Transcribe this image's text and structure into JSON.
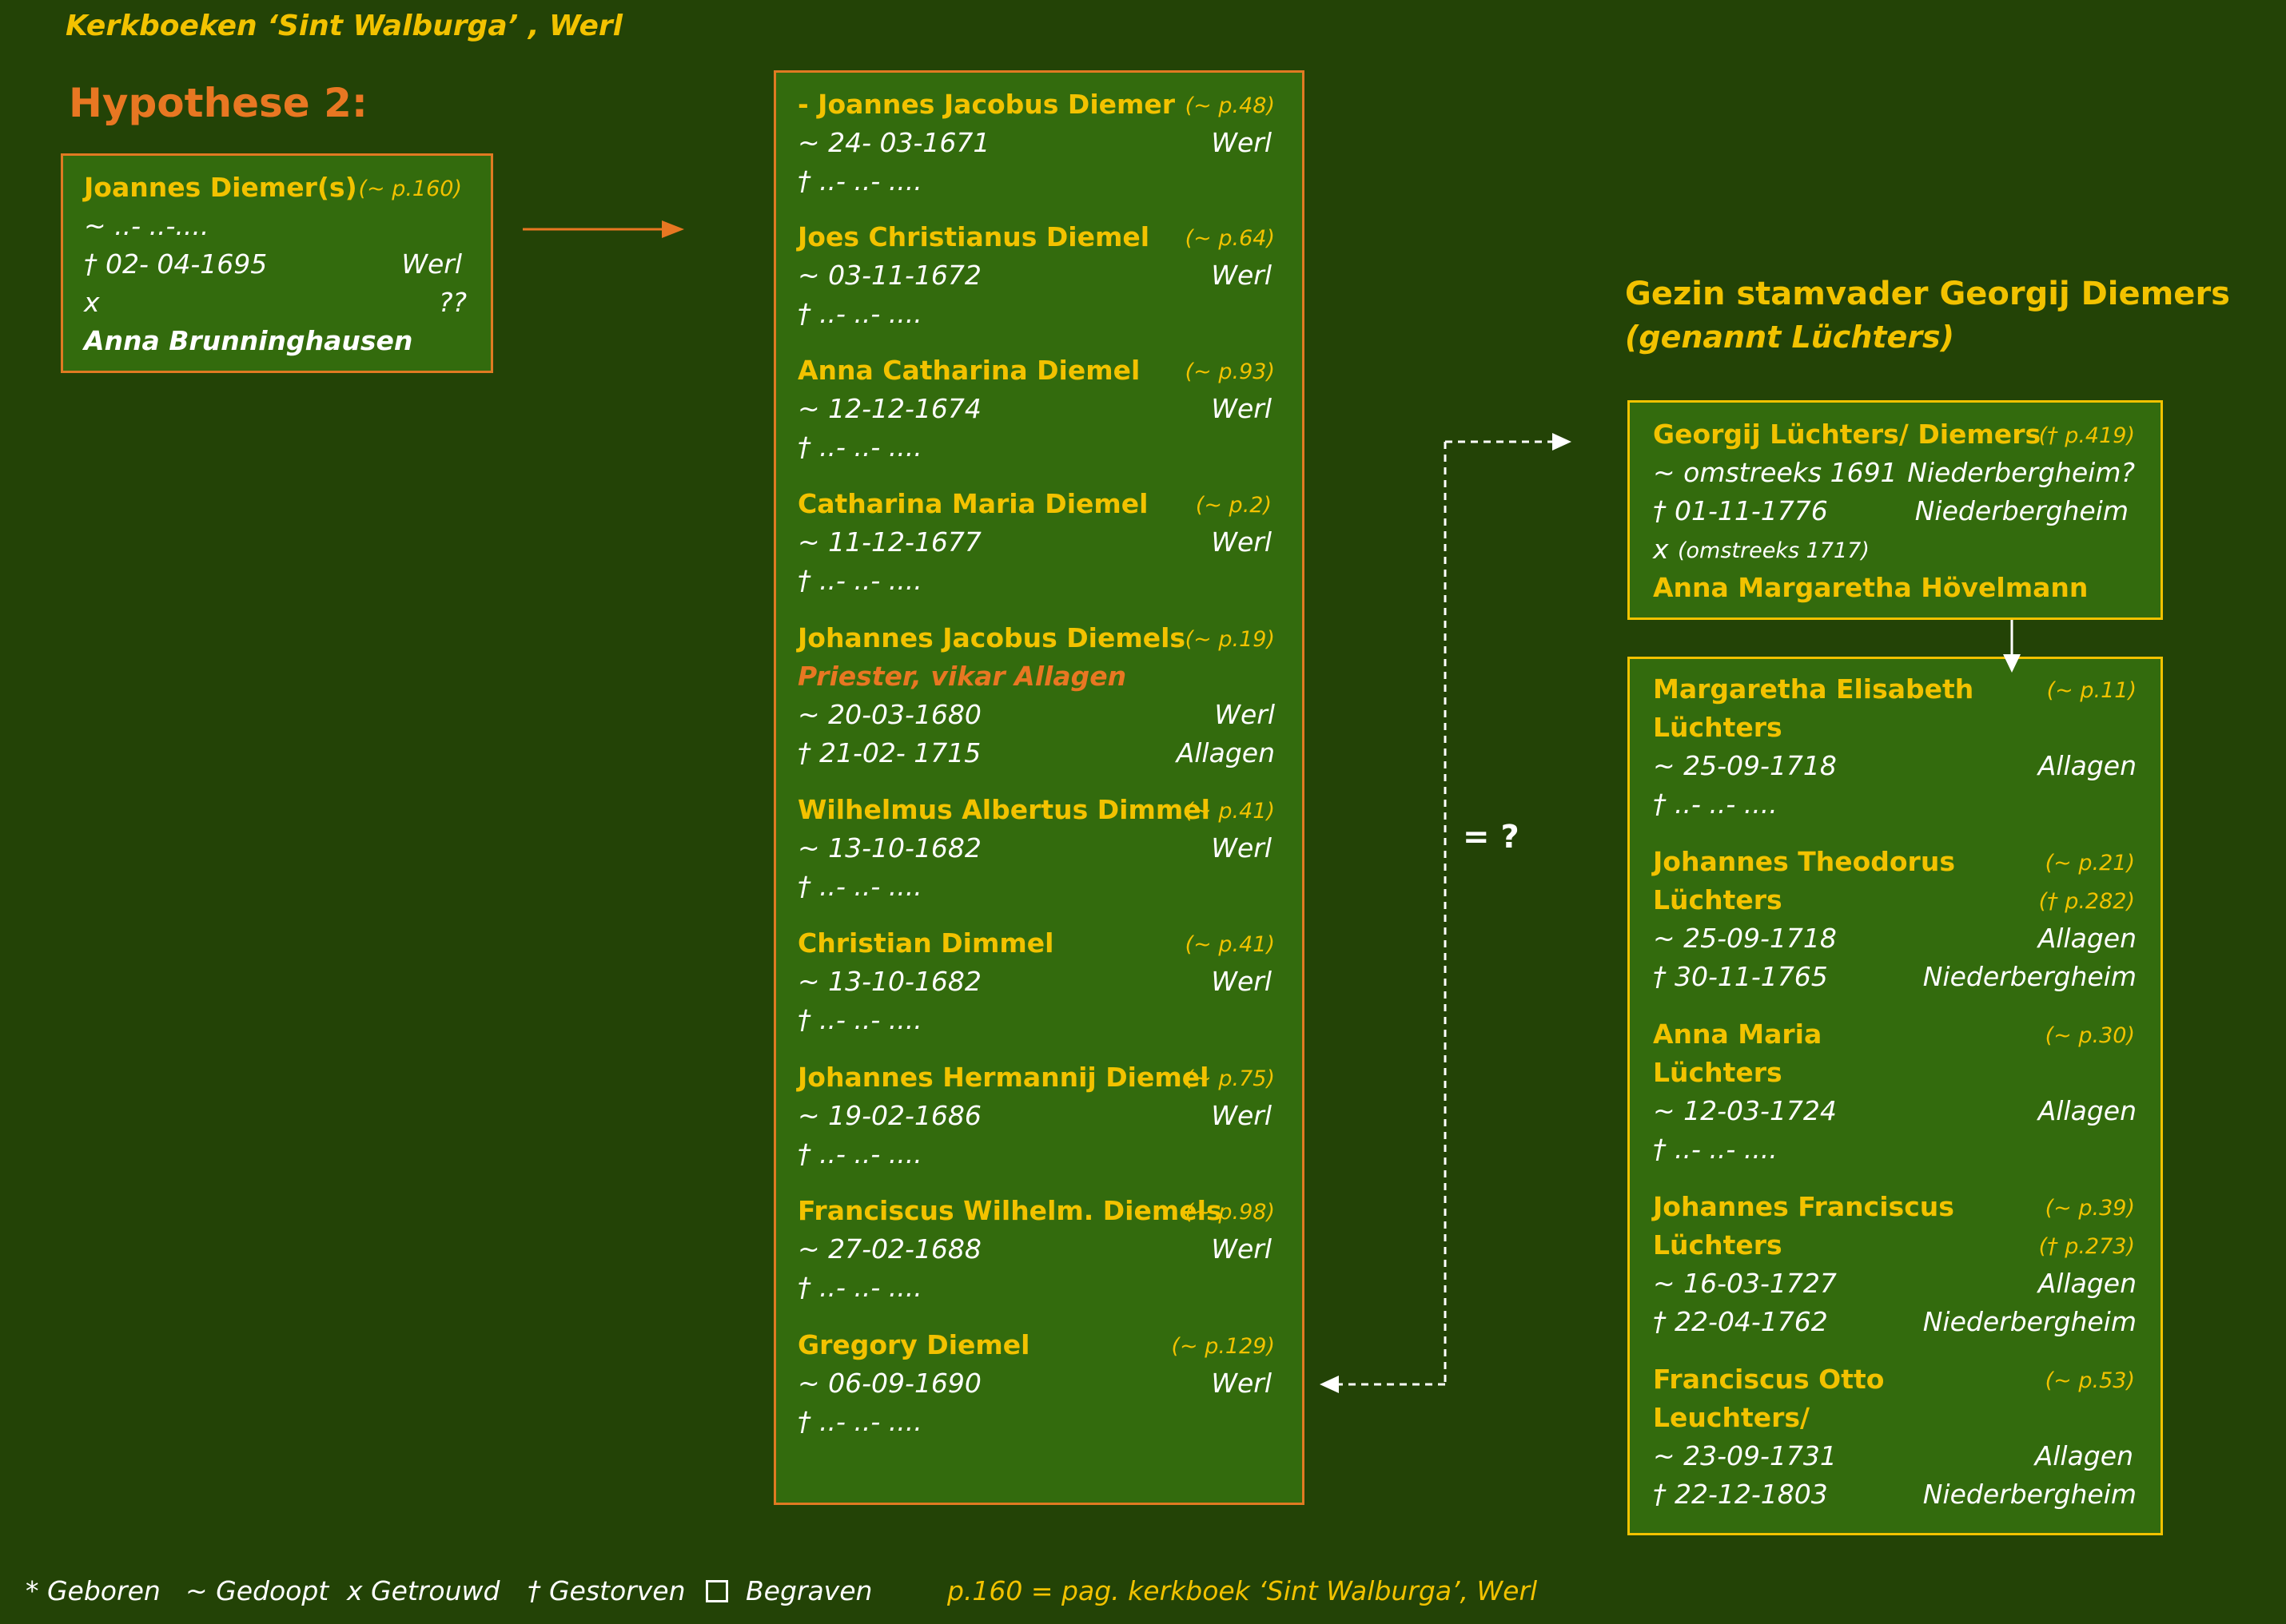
{
  "header": {
    "title": "Kerkboeken ‘Sint Walburga’ , Werl",
    "hypothesis": "Hypothese 2:"
  },
  "father": {
    "name": "Joannes Diemer(s)",
    "ref": "(~ p.160)",
    "baptism": "~ ..- ..-....",
    "death": "† 02- 04-1695",
    "death_place": "Werl",
    "marriage": "x",
    "marriage_note": "??",
    "spouse": "Anna Brunninghausen"
  },
  "children": [
    {
      "name": "- Joannes Jacobus  Diemer",
      "ref": "(~ p.48)",
      "baptism": "~ 24- 03-1671",
      "baptism_place": "Werl",
      "death": "† ..- ..- ...."
    },
    {
      "name": "Joes Christianus Diemel",
      "ref": "(~ p.64)",
      "baptism": "~ 03-11-1672",
      "baptism_place": "Werl",
      "death": "† ..- ..- ...."
    },
    {
      "name": "Anna Catharina Diemel",
      "ref": "(~ p.93)",
      "baptism": "~ 12-12-1674",
      "baptism_place": "Werl",
      "death": "† ..- ..- ...."
    },
    {
      "name": "Catharina Maria Diemel",
      "ref": "(~ p.2)",
      "baptism": "~ 11-12-1677",
      "baptism_place": "Werl",
      "death": "† ..- ..- ...."
    },
    {
      "name": "Johannes Jacobus  Diemels",
      "ref": "(~ p.19)",
      "note": "Priester, vikar Allagen",
      "baptism": "~ 20-03-1680",
      "baptism_place": "Werl",
      "death": "† 21-02- 1715",
      "death_place": "Allagen"
    },
    {
      "name": "Wilhelmus Albertus Dimmel",
      "ref": "(~ p.41)",
      "baptism": "~ 13-10-1682",
      "baptism_place": "Werl",
      "death": "† ..- ..- ...."
    },
    {
      "name": "Christian Dimmel",
      "ref": "(~ p.41)",
      "baptism": "~ 13-10-1682",
      "baptism_place": "Werl",
      "death": "† ..- ..- ...."
    },
    {
      "name": "Johannes Hermannij  Diemel",
      "ref": "(~ p.75)",
      "baptism": "~ 19-02-1686",
      "baptism_place": "Werl",
      "death": "† ..- ..- ...."
    },
    {
      "name": "Franciscus Wilhelm. Diemels",
      "ref": "(~ p.98)",
      "baptism": "~ 27-02-1688",
      "baptism_place": "Werl",
      "death": "† ..- ..- ...."
    },
    {
      "name": "Gregory Diemel",
      "ref": "(~ p.129)",
      "baptism": "~ 06-09-1690",
      "baptism_place": "Werl",
      "death": "† ..- ..- ...."
    }
  ],
  "equals_label": "= ?",
  "family_heading": {
    "line1": "Gezin stamvader  Georgij Diemers",
    "line2": "(genannt Lüchters)"
  },
  "georgij": {
    "name": "Georgij Lüchters/ Diemers",
    "ref": "(† p.419)",
    "baptism": "~ omstreeks 1691",
    "baptism_place": "Niederbergheim?",
    "death": "† 01-11-1776",
    "death_place": "Niederbergheim",
    "marriage": "x",
    "marriage_note": "(omstreeks 1717)",
    "spouse": "Anna Margaretha Hövelmann"
  },
  "georgij_children": [
    {
      "name1": "Margaretha Elisabeth",
      "name2": "Lüchters",
      "ref1": "(~ p.11)",
      "ref2": "",
      "baptism": "~  25-09-1718",
      "baptism_place": "Allagen",
      "death": "†  ..-  ..-   ....",
      "death_place": ""
    },
    {
      "name1": "Johannes Theodorus",
      "name2": "Lüchters",
      "ref1": "(~ p.21)",
      "ref2": "(† p.282)",
      "baptism": "~  25-09-1718",
      "baptism_place": "Allagen",
      "death": "†  30-11-1765",
      "death_place": "Niederbergheim"
    },
    {
      "name1": "Anna Maria",
      "name2": "Lüchters",
      "ref1": "(~ p.30)",
      "ref2": "",
      "baptism": "~ 12-03-1724",
      "baptism_place": "Allagen",
      "death": "†  ..-  ..-   ....",
      "death_place": ""
    },
    {
      "name1": "Johannes Franciscus",
      "name2": "Lüchters",
      "ref1": "(~ p.39)",
      "ref2": "(† p.273)",
      "baptism": "~  16-03-1727",
      "baptism_place": "Allagen",
      "death": "†  22-04-1762",
      "death_place": "Niederbergheim"
    },
    {
      "name1": "Franciscus Otto",
      "name2": "Leuchters/",
      "ref1": "(~ p.53)",
      "ref2": "",
      "baptism": "~  23-09-1731",
      "baptism_place": "Allagen",
      "death": "†  22-12-1803",
      "death_place": "Niederbergheim"
    }
  ],
  "legend": {
    "born": "* Geboren",
    "baptized": "~ Gedoopt",
    "married": "x Getrouwd",
    "died": "† Gestorven",
    "buried": "Begraven",
    "page_note": "p.160 = pag. kerkboek ‘Sint Walburga’, Werl"
  },
  "colors": {
    "background": "#234306",
    "box_fill": "#336b0d",
    "accent_yellow": "#f2c200",
    "accent_orange": "#e87722",
    "border_orange": "#e07a22"
  }
}
